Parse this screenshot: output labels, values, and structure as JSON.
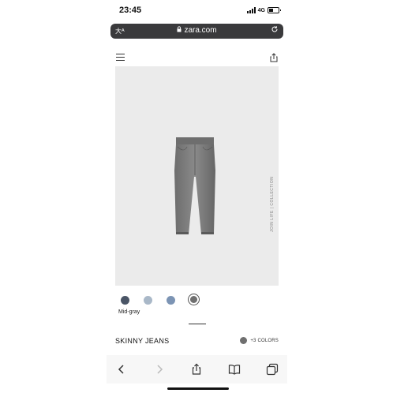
{
  "status_bar": {
    "time": "23:45",
    "network": "4G",
    "icons": [
      "signal-icon",
      "battery-icon"
    ]
  },
  "browser": {
    "text_size_button": "大ᴬ",
    "url": "zara.com",
    "icons": [
      "lock-icon",
      "reload-icon"
    ]
  },
  "site_header": {
    "icons": [
      "menu-icon",
      "share-icon"
    ]
  },
  "product": {
    "image_side_text": "JOIN LIFE | COLLECTION",
    "name": "SKINNY JEANS",
    "selected_color_name": "Mid-gray",
    "swatches": [
      {
        "color": "#4a5566"
      },
      {
        "color": "#a9b8c8"
      },
      {
        "color": "#7c94b4"
      },
      {
        "color": "#6f6f6f",
        "selected": true
      }
    ],
    "more_colors_label": "+3 COLORS",
    "more_colors_dot": "#6f6f6f"
  },
  "toolbar": {
    "icons": [
      "back-icon",
      "forward-icon",
      "share-icon",
      "bookmarks-icon",
      "tabs-icon"
    ]
  }
}
